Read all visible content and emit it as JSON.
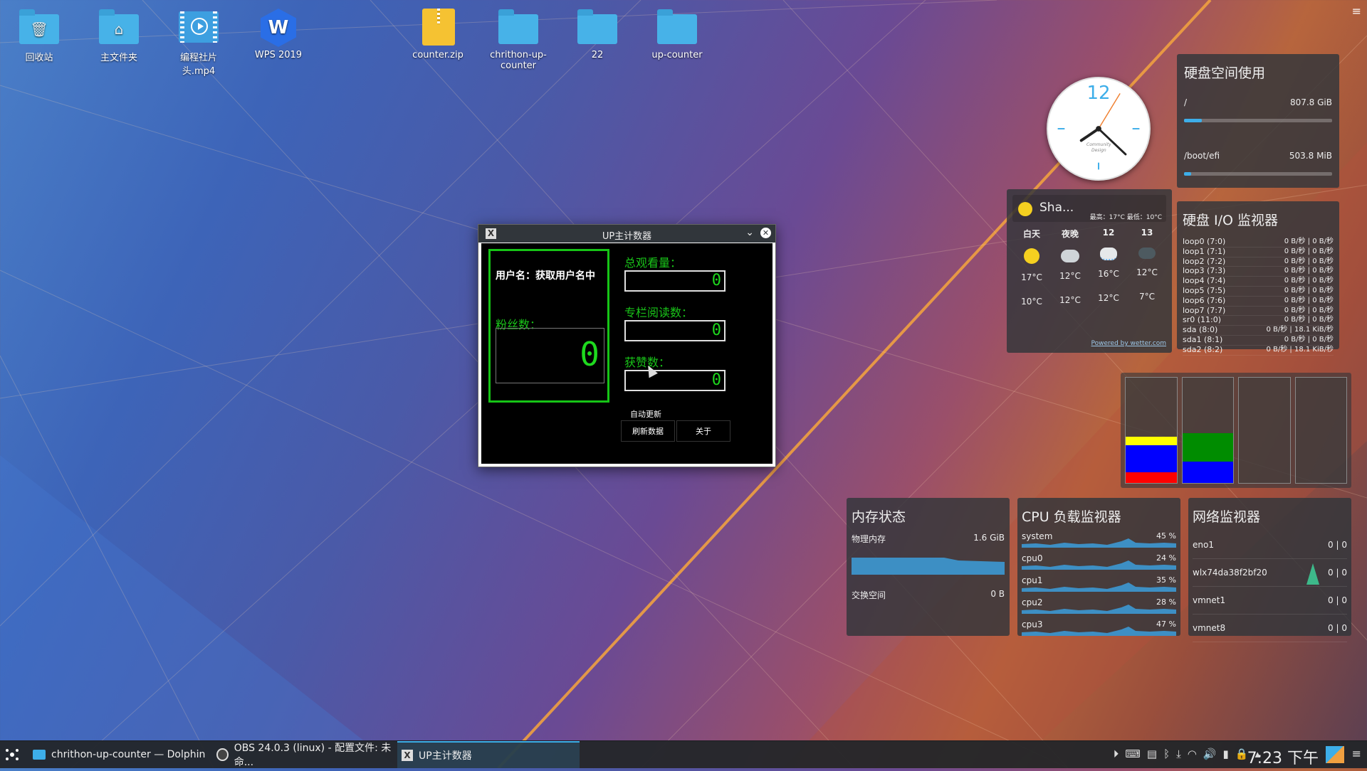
{
  "desktop": {
    "icons": [
      {
        "label": "回收站",
        "icon": "trash-folder-icon"
      },
      {
        "label": "主文件夹",
        "icon": "home-folder-icon"
      },
      {
        "label": "编程社片头.mp4",
        "icon": "video-file-icon"
      },
      {
        "label": "WPS 2019",
        "icon": "wps-app-icon"
      },
      {
        "label": "counter.zip",
        "icon": "zip-file-icon"
      },
      {
        "label": "chrithon-up-counter",
        "icon": "folder-icon"
      },
      {
        "label": "22",
        "icon": "folder-icon"
      },
      {
        "label": "up-counter",
        "icon": "folder-icon"
      }
    ],
    "wps_glyph": "W"
  },
  "clock": {
    "number": "12",
    "brand_top": "Community",
    "brand_bottom": "Design"
  },
  "disk_space": {
    "title": "硬盘空间使用",
    "items": [
      {
        "mount": "/",
        "value": "807.8 GiB",
        "fill": 0.12
      },
      {
        "mount": "/boot/efi",
        "value": "503.8 MiB",
        "fill": 0.05
      }
    ]
  },
  "weather": {
    "location": "Sha...",
    "high_low": "最高：17°C 最低：10°C",
    "columns": [
      {
        "label": "白天",
        "icon": "partly-sunny-icon",
        "high": "17°C",
        "low": "10°C"
      },
      {
        "label": "夜晚",
        "icon": "cloudy-night-icon",
        "high": "12°C",
        "low": "12°C"
      },
      {
        "label": "12",
        "icon": "rain-icon",
        "high": "16°C",
        "low": "12°C"
      },
      {
        "label": "13",
        "icon": "overcast-icon",
        "high": "12°C",
        "low": "7°C"
      }
    ],
    "powered": "Powered by wetter.com"
  },
  "disk_io": {
    "title": "硬盘 I/O 监视器",
    "rows": [
      {
        "name": "loop0 (7:0)",
        "read": "0 B/秒",
        "write": "0 B/秒"
      },
      {
        "name": "loop1 (7:1)",
        "read": "0 B/秒",
        "write": "0 B/秒"
      },
      {
        "name": "loop2 (7:2)",
        "read": "0 B/秒",
        "write": "0 B/秒"
      },
      {
        "name": "loop3 (7:3)",
        "read": "0 B/秒",
        "write": "0 B/秒"
      },
      {
        "name": "loop4 (7:4)",
        "read": "0 B/秒",
        "write": "0 B/秒"
      },
      {
        "name": "loop5 (7:5)",
        "read": "0 B/秒",
        "write": "0 B/秒"
      },
      {
        "name": "loop6 (7:6)",
        "read": "0 B/秒",
        "write": "0 B/秒"
      },
      {
        "name": "loop7 (7:7)",
        "read": "0 B/秒",
        "write": "0 B/秒"
      },
      {
        "name": "sr0 (11:0)",
        "read": "0 B/秒",
        "write": "0 B/秒"
      },
      {
        "name": "sda (8:0)",
        "read": "0 B/秒",
        "write": "18.1 KiB/秒"
      },
      {
        "name": "sda1 (8:1)",
        "read": "0 B/秒",
        "write": "0 B/秒"
      },
      {
        "name": "sda2 (8:2)",
        "read": "0 B/秒",
        "write": "18.1 KiB/秒"
      }
    ]
  },
  "colors": {
    "accent": "#3daee9",
    "yellow": "#ffff00",
    "blue": "#0000ff",
    "red": "#ff0000",
    "green": "#008c00",
    "lcd_green": "#1ed91e"
  },
  "bar_graphs": [
    {
      "segments": [
        {
          "color": "#ff0000",
          "fraction": 0.1
        },
        {
          "color": "#0000ff",
          "fraction": 0.26
        },
        {
          "color": "#ffff00",
          "fraction": 0.08
        }
      ]
    },
    {
      "segments": [
        {
          "color": "#0000ff",
          "fraction": 0.2
        },
        {
          "color": "#008c00",
          "fraction": 0.27
        }
      ]
    },
    {
      "segments": []
    },
    {
      "segments": []
    }
  ],
  "memory": {
    "title": "内存状态",
    "physical_label": "物理内存",
    "physical_value": "1.6 GiB",
    "swap_label": "交换空间",
    "swap_value": "0 B"
  },
  "cpu": {
    "title": "CPU 负载监视器",
    "rows": [
      {
        "name": "system",
        "value": "45 %"
      },
      {
        "name": "cpu0",
        "value": "24 %"
      },
      {
        "name": "cpu1",
        "value": "35 %"
      },
      {
        "name": "cpu2",
        "value": "28 %"
      },
      {
        "name": "cpu3",
        "value": "47 %"
      }
    ]
  },
  "network": {
    "title": "网络监视器",
    "rows": [
      {
        "name": "eno1",
        "value": "0 | 0"
      },
      {
        "name": "wlx74da38f2bf20",
        "value": "0 | 0"
      },
      {
        "name": "vmnet1",
        "value": "0 | 0"
      },
      {
        "name": "vmnet8",
        "value": "0 | 0"
      }
    ]
  },
  "app": {
    "title": "UP主计数器",
    "username": "用户名：获取用户名中",
    "fans_label": "粉丝数：",
    "fans_value": "0",
    "views_label": "总观看量：",
    "views_value": "0",
    "reads_label": "专栏阅读数：",
    "reads_value": "0",
    "likes_label": "获赞数：",
    "likes_value": "0",
    "auto_update": "自动更新",
    "refresh": "刷新数据",
    "about": "关于"
  },
  "taskbar": {
    "tasks": [
      {
        "label": "chrithon-up-counter — Dolphin",
        "icon": "dolphin-icon"
      },
      {
        "label": "OBS 24.0.3 (linux) - 配置文件: 未命...",
        "icon": "obs-icon"
      },
      {
        "label": "UP主计数器",
        "icon": "x-app-icon"
      }
    ],
    "time": "7:23 下午"
  }
}
